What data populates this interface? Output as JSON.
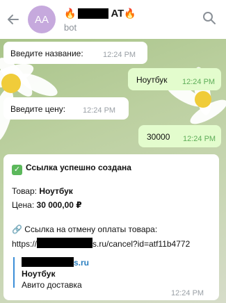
{
  "header": {
    "avatar_initials": "AA",
    "title_emoji_left": "🔥",
    "title_suffix": "AT",
    "title_emoji_right": "🔥",
    "subtitle": "bot"
  },
  "messages": [
    {
      "direction": "in",
      "text": "Введите название:",
      "time": "12:24 PM"
    },
    {
      "direction": "out",
      "text": "Ноутбук",
      "time": "12:24 PM"
    },
    {
      "direction": "in",
      "text": "Введите цену:",
      "time": "12:24 PM"
    },
    {
      "direction": "out",
      "text": "30000",
      "time": "12:24 PM"
    }
  ],
  "result": {
    "headline": "Ссылка успешно создана",
    "product_label": "Товар:",
    "product_value": "Ноутбук",
    "price_label": "Цена:",
    "price_value": "30 000,00 ₽",
    "cancel_title": "🔗 Ссылка на отмену оплаты товара:",
    "link_prefix": "https://",
    "link_suffix": "s.ru/cancel?id=atf11b4772",
    "preview_site_suffix": "s.ru",
    "preview_title": "Ноутбук",
    "preview_desc": "Авито доставка",
    "time": "12:24 PM"
  },
  "colors": {
    "avatar": "#c6a9dd",
    "incoming_bubble": "#ffffff",
    "outgoing_bubble": "#e3fccd",
    "link": "#2a7fc0",
    "check": "#5cb85c"
  },
  "icons": {
    "back": "arrow-left-icon",
    "search": "search-icon",
    "check": "check-square-icon",
    "link": "chain-link-icon"
  }
}
